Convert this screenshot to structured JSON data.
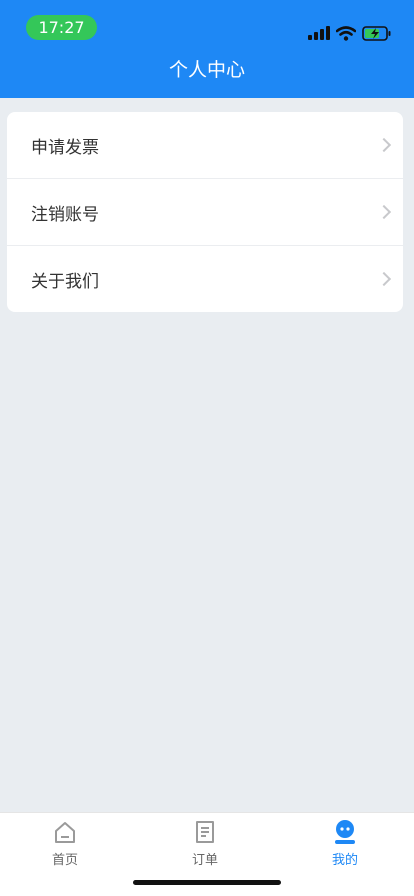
{
  "status": {
    "time": "17:27"
  },
  "header": {
    "title": "个人中心"
  },
  "menu": {
    "items": [
      {
        "label": "申请发票",
        "icon": "chevron-right-icon"
      },
      {
        "label": "注销账号",
        "icon": "chevron-right-icon"
      },
      {
        "label": "关于我们",
        "icon": "chevron-right-icon"
      }
    ]
  },
  "tabbar": {
    "items": [
      {
        "label": "首页",
        "icon": "home-icon",
        "active": false
      },
      {
        "label": "订单",
        "icon": "order-icon",
        "active": false
      },
      {
        "label": "我的",
        "icon": "profile-icon",
        "active": true
      }
    ]
  },
  "colors": {
    "primary": "#1e88f5",
    "background": "#e9edf1",
    "status_pill": "#34c759"
  }
}
